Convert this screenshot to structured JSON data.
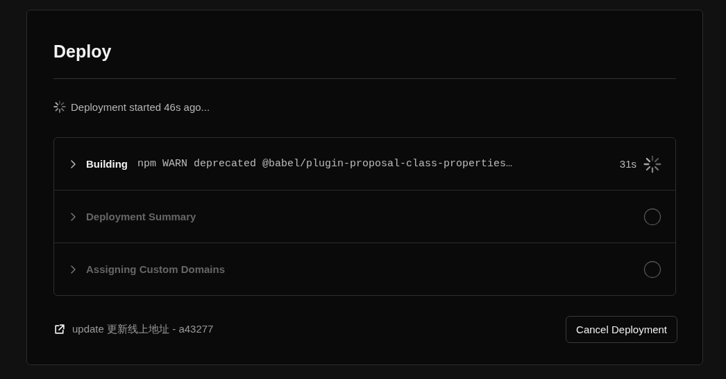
{
  "title": "Deploy",
  "status": {
    "text": "Deployment started 46s ago..."
  },
  "steps": [
    {
      "label": "Building",
      "log": "npm WARN deprecated @babel/plugin-proposal-class-properties…",
      "duration": "31s",
      "kind": "running"
    },
    {
      "label": "Deployment Summary",
      "kind": "pending"
    },
    {
      "label": "Assigning Custom Domains",
      "kind": "pending"
    }
  ],
  "commit_link": "update 更新线上地址 - a43277",
  "cancel_button": "Cancel Deployment"
}
